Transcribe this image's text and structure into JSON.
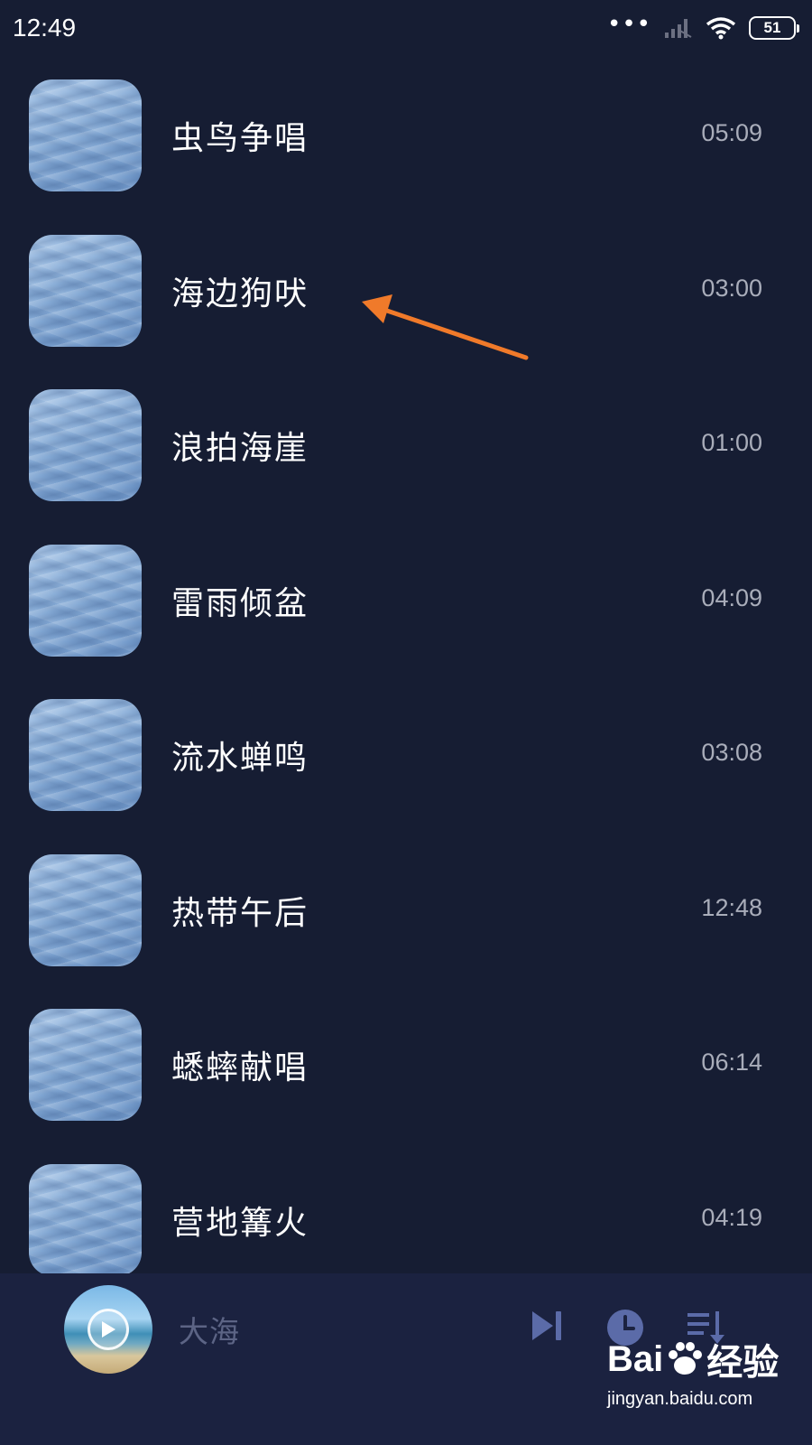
{
  "status_bar": {
    "time": "12:49",
    "battery": "51"
  },
  "songs": [
    {
      "title": "虫鸟争唱",
      "duration": "05:09"
    },
    {
      "title": "海边狗吠",
      "duration": "03:00"
    },
    {
      "title": "浪拍海崖",
      "duration": "01:00"
    },
    {
      "title": "雷雨倾盆",
      "duration": "04:09"
    },
    {
      "title": "流水蝉鸣",
      "duration": "03:08"
    },
    {
      "title": "热带午后",
      "duration": "12:48"
    },
    {
      "title": "蟋蟀献唱",
      "duration": "06:14"
    },
    {
      "title": "营地篝火",
      "duration": "04:19"
    }
  ],
  "player": {
    "now_playing": "大海"
  },
  "watermark": {
    "brand_left": "Bai",
    "brand_right": "经验",
    "url": "jingyan.baidu.com"
  },
  "colors": {
    "background": "#161d33",
    "player_bar": "#1b2240",
    "accent_icon": "#5b6ba8",
    "annotation_arrow": "#f07a2a",
    "duration_text": "#a9adba"
  },
  "icons": {
    "signal": "signal-bars-icon",
    "wifi": "wifi-icon",
    "next": "skip-next-icon",
    "timer": "clock-icon",
    "playlist": "playlist-sort-icon",
    "play": "play-icon"
  }
}
